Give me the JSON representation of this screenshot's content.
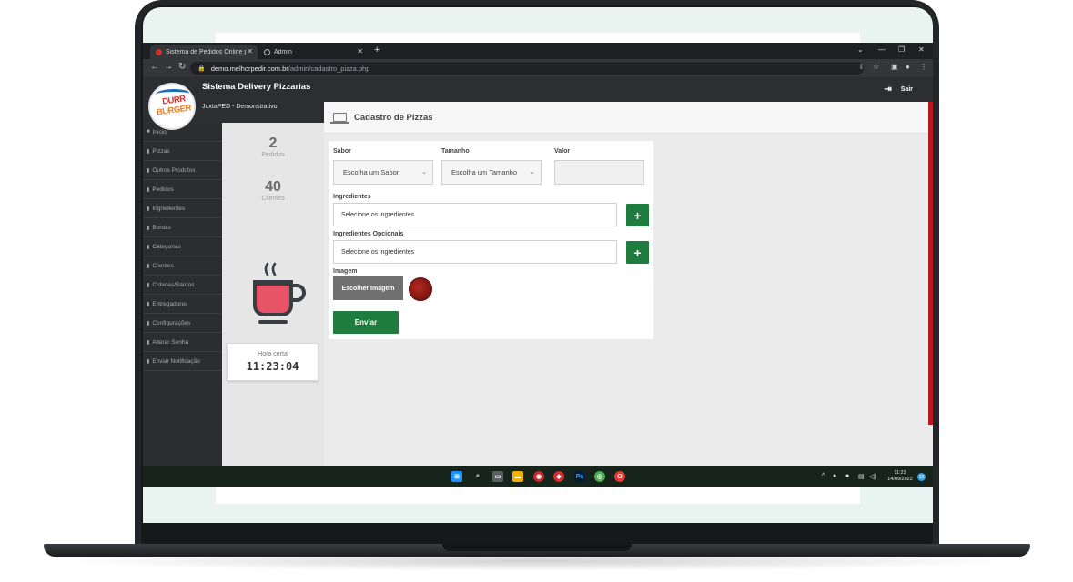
{
  "browser": {
    "tabs": [
      {
        "label": "Sistema de Pedidos Online para Delivery"
      },
      {
        "label": "Admin"
      }
    ],
    "new_tab": "+",
    "url_host": "demo.melhorpedir.com.br",
    "url_path": "/admin/cadastro_pizza.php"
  },
  "brand": {
    "logo_line1": "DURR",
    "logo_line2": "BURGER",
    "title": "Sistema Delivery Pizzarias",
    "subtitle": "JuxtaPED - Demonstrativo"
  },
  "sidebar": {
    "items": [
      {
        "label": "Inicio"
      },
      {
        "label": "Pizzas"
      },
      {
        "label": "Outros Produtos"
      },
      {
        "label": "Pedidos"
      },
      {
        "label": "Ingredientes"
      },
      {
        "label": "Bordas"
      },
      {
        "label": "Categorias"
      },
      {
        "label": "Clientes"
      },
      {
        "label": "Cidades/Bairros"
      },
      {
        "label": "Entregadores"
      },
      {
        "label": "Configurações"
      },
      {
        "label": "Alterar Senha"
      },
      {
        "label": "Enviar Notificação"
      }
    ]
  },
  "stats": {
    "orders_count": "2",
    "orders_label": "Pedidos",
    "clients_count": "40",
    "clients_label": "Clientes"
  },
  "clock": {
    "label": "Hora certa",
    "time": "11:23:04"
  },
  "topbar": {
    "logout_label": "Sair"
  },
  "page": {
    "title": "Cadastro de Pizzas"
  },
  "form": {
    "flavor_label": "Sabor",
    "flavor_value": "Escolha um Sabor",
    "size_label": "Tamanho",
    "size_value": "Escolha um Tamanho",
    "price_label": "Valor",
    "ingredients_label": "Ingredientes",
    "ingredients_placeholder": "Selecione os ingredientes",
    "optional_label": "Ingredientes Opcionais",
    "optional_placeholder": "Selecione os ingredientes",
    "add_symbol": "+",
    "image_label": "Imagem",
    "choose_image_label": "Escolher Imagem",
    "submit_label": "Enviar"
  },
  "taskbar": {
    "time": "11:23",
    "date": "14/09/2022",
    "notifications": "15"
  },
  "colors": {
    "accent_green": "#1e7d3e",
    "accent_red": "#b8171d",
    "dark_chrome": "#2d2e31"
  }
}
